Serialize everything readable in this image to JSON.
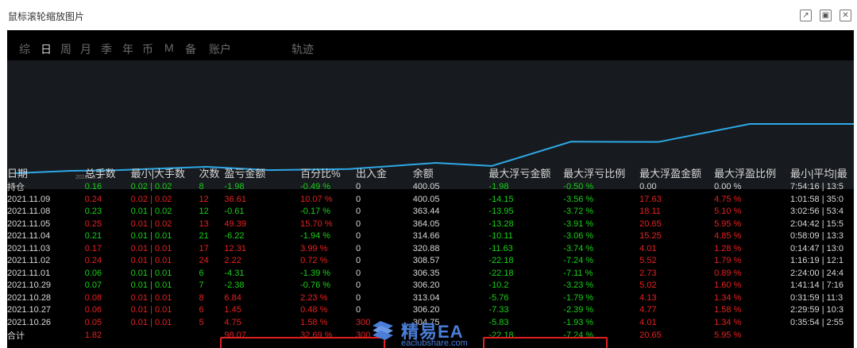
{
  "window": {
    "title": "鼠标滚轮缩放图片",
    "controls": [
      "↗",
      "▣",
      "✕"
    ]
  },
  "tabs": [
    {
      "label": "综",
      "active": false
    },
    {
      "label": "日",
      "active": true
    },
    {
      "label": "周",
      "active": false
    },
    {
      "label": "月",
      "active": false
    },
    {
      "label": "季",
      "active": false
    },
    {
      "label": "年",
      "active": false
    },
    {
      "label": "币",
      "active": false
    },
    {
      "label": "M",
      "active": false
    },
    {
      "label": "备",
      "active": false
    },
    {
      "label": "账户",
      "active": false
    },
    {
      "label": "轨迹",
      "active": false
    }
  ],
  "chart_data": {
    "type": "line",
    "x_tick_label": "2021.10.26",
    "series": [
      {
        "values": [
          300,
          304.75,
          306.2,
          313.04,
          306.35,
          308.57,
          320.88,
          314.66,
          364.05,
          363.44,
          400.05,
          400.05
        ]
      }
    ],
    "line_color": "#2ea8e6",
    "background": "#171a1e"
  },
  "table": {
    "headers": [
      "日期",
      "总手数",
      "最小|大手数",
      "次数",
      "盈亏金额",
      "百分比%",
      "出入金",
      "余额",
      "最大浮亏金额",
      "最大浮亏比例",
      "最大浮盈金额",
      "最大浮盈比例",
      "最小|平均|最"
    ],
    "rows": [
      {
        "cells": [
          "持仓",
          "0.16",
          "0.02 | 0.02",
          "8",
          "-1.98",
          "-0.49 %",
          "0",
          "400.05",
          "-1.98",
          "-0.50 %",
          "0.00",
          "0.00 %",
          "7:54:16 | 13:5"
        ],
        "tone": "g"
      },
      {
        "cells": [
          "2021.11.09",
          "0.24",
          "0.02 | 0.02",
          "12",
          "36.61",
          "10.07 %",
          "0",
          "400.05",
          "-14.15",
          "-3.56 %",
          "17.63",
          "4.75 %",
          "1:01:58 | 35:0"
        ],
        "tone": "r"
      },
      {
        "cells": [
          "2021.11.08",
          "0.23",
          "0.01 | 0.02",
          "12",
          "-0.61",
          "-0.17 %",
          "0",
          "363.44",
          "-13.95",
          "-3.72 %",
          "18.11",
          "5.10 %",
          "3:02:56 | 53:4"
        ],
        "tone": "g"
      },
      {
        "cells": [
          "2021.11.05",
          "0.25",
          "0.01 | 0.02",
          "13",
          "49.39",
          "15.70 %",
          "0",
          "364.05",
          "-13.28",
          "-3.91 %",
          "20.65",
          "5.95 %",
          "2:04:42 | 15:5"
        ],
        "tone": "r"
      },
      {
        "cells": [
          "2021.11.04",
          "0.21",
          "0.01 | 0.01",
          "21",
          "-6.22",
          "-1.94 %",
          "0",
          "314.66",
          "-10.11",
          "-3.06 %",
          "15.25",
          "4.85 %",
          "0:58:09 | 13:3"
        ],
        "tone": "g"
      },
      {
        "cells": [
          "2021.11.03",
          "0.17",
          "0.01 | 0.01",
          "17",
          "12.31",
          "3.99 %",
          "0",
          "320.88",
          "-11.63",
          "-3.74 %",
          "4.01",
          "1.28 %",
          "0:14:47 | 13:0"
        ],
        "tone": "r"
      },
      {
        "cells": [
          "2021.11.02",
          "0.24",
          "0.01 | 0.01",
          "24",
          "2.22",
          "0.72 %",
          "0",
          "308.57",
          "-22.18",
          "-7.24 %",
          "5.52",
          "1.79 %",
          "1:16:19 | 12:1"
        ],
        "tone": "r"
      },
      {
        "cells": [
          "2021.11.01",
          "0.06",
          "0.01 | 0.01",
          "6",
          "-4.31",
          "-1.39 %",
          "0",
          "306.35",
          "-22.18",
          "-7.11 %",
          "2.73",
          "0.89 %",
          "2:24:00 | 24:4"
        ],
        "tone": "g"
      },
      {
        "cells": [
          "2021.10.29",
          "0.07",
          "0.01 | 0.01",
          "7",
          "-2.38",
          "-0.76 %",
          "0",
          "306.20",
          "-10.2",
          "-3.23 %",
          "5.02",
          "1.60 %",
          "1:41:14 | 7:16"
        ],
        "tone": "g"
      },
      {
        "cells": [
          "2021.10.28",
          "0.08",
          "0.01 | 0.01",
          "8",
          "6.84",
          "2.23 %",
          "0",
          "313.04",
          "-5.76",
          "-1.79 %",
          "4.13",
          "1.34 %",
          "0:31:59 | 11:3"
        ],
        "tone": "r"
      },
      {
        "cells": [
          "2021.10.27",
          "0.06",
          "0.01 | 0.01",
          "6",
          "1.45",
          "0.48 %",
          "0",
          "306.20",
          "-7.33",
          "-2.39 %",
          "4.77",
          "1.58 %",
          "2:29:59 | 10:3"
        ],
        "tone": "r"
      },
      {
        "cells": [
          "2021.10.26",
          "0.05",
          "0.01 | 0.01",
          "5",
          "4.75",
          "1.58 %",
          "300",
          "304.75",
          "-5.83",
          "-1.93 %",
          "4.01",
          "1.34 %",
          "0:35:54 | 2:55"
        ],
        "tone": "r"
      },
      {
        "cells": [
          "合计",
          "1.82",
          "",
          "",
          "98.07",
          "32.69 %",
          "300",
          "",
          "-22.18",
          "-7.24 %",
          "20.65",
          "5.95 %",
          ""
        ],
        "tone": "r"
      }
    ]
  },
  "watermark": {
    "big": "精易EA",
    "small": "eaclubshare.com",
    "color": "#4a7ed8"
  }
}
